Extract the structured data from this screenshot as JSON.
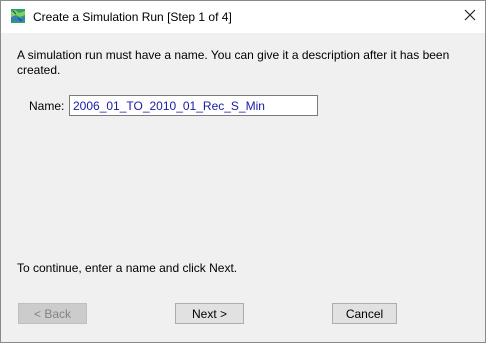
{
  "window": {
    "title": "Create a Simulation Run [Step 1 of 4]",
    "icon": "simulation-map-icon"
  },
  "content": {
    "instruction": "A simulation run must have a name. You can give it a description after it has been created.",
    "name_label": "Name:",
    "name_value": "2006_01_TO_2010_01_Rec_S_Min",
    "hint": "To continue, enter a name and click Next."
  },
  "buttons": {
    "back": "< Back",
    "next": "Next >",
    "cancel": "Cancel"
  },
  "colors": {
    "dialog_background": "#f0f0f0",
    "titlebar_background": "#ffffff",
    "input_text": "#1a1aa6",
    "disabled_text": "#838383"
  }
}
